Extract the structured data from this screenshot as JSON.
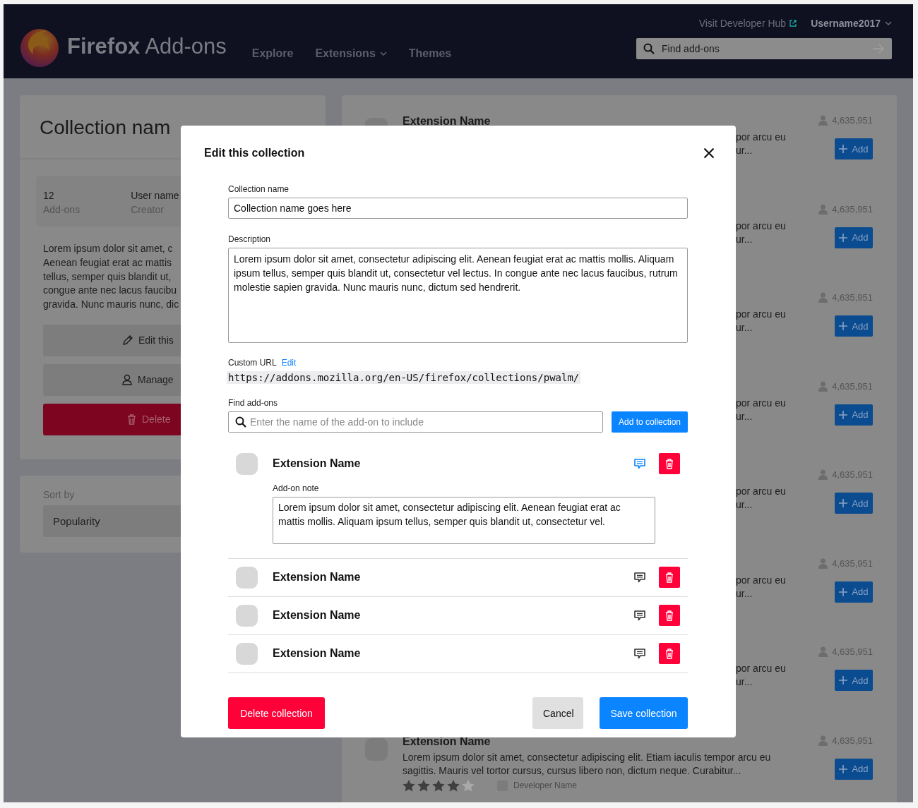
{
  "header": {
    "brand_bold": "Firefox",
    "brand_light": "Add-ons",
    "nav": [
      {
        "label": "Explore",
        "dropdown": false
      },
      {
        "label": "Extensions",
        "dropdown": true
      },
      {
        "label": "Themes",
        "dropdown": false
      }
    ],
    "developer_link": "Visit Developer Hub",
    "user_menu": "Username2017",
    "search": {
      "placeholder": "Find add-ons"
    }
  },
  "collection": {
    "title": "Collection nam",
    "stats": [
      {
        "value": "12",
        "label": "Add-ons"
      },
      {
        "value": "User name",
        "label": "Creator"
      }
    ],
    "description_lines": [
      "Lorem ipsum dolor sit amet, c",
      "Aenean feugiat erat ac mattis",
      "tellus, semper quis blandit ut,",
      "congue ante nec lacus faucibu",
      "gravida. Nunc mauris nunc, dic"
    ],
    "buttons": [
      {
        "kind": "edit",
        "label": "Edit this"
      },
      {
        "kind": "manage",
        "label": "Manage"
      },
      {
        "kind": "delete",
        "label": "Delete"
      }
    ]
  },
  "sort": {
    "label": "Sort by",
    "value": "Popularity"
  },
  "addon_list": [
    {
      "kind": "partial",
      "name": "Extension Name",
      "description_lines": [
        "por arcu eu",
        "ur..."
      ],
      "users": "4,635,951",
      "button": "Add"
    },
    {
      "kind": "partial",
      "description_lines": [
        "por arcu eu",
        "ur..."
      ],
      "users": "4,635,951",
      "button": "Add"
    },
    {
      "kind": "partial",
      "description_lines": [
        "por arcu eu",
        "ur..."
      ],
      "users": "4,635,951",
      "button": "Add"
    },
    {
      "kind": "partial",
      "description_lines": [
        "por arcu eu",
        "ur..."
      ],
      "users": "4,635,951",
      "button": "Add"
    },
    {
      "kind": "partial",
      "description_lines": [
        "por arcu eu",
        "ur..."
      ],
      "users": "4,635,951",
      "button": "Add"
    },
    {
      "kind": "partial",
      "description_lines": [
        "por arcu eu",
        "ur..."
      ],
      "users": "4,635,951",
      "button": "Add"
    },
    {
      "kind": "partial",
      "description_lines": [
        "por arcu eu",
        "ur..."
      ],
      "users": "4,635,951",
      "button": "Add"
    },
    {
      "kind": "full",
      "name": "Extension Name",
      "description_lines": [
        "Lorem ipsum dolor sit amet, consectetur adipiscing elit. Etiam iaculis tempor arcu eu",
        "sagittis. Mauris vel tortor cursus, cursus libero non, dictum neque. Curabitur..."
      ],
      "stars": 4,
      "developer": "Developer Name",
      "users": "4,635,951",
      "button": "Add"
    }
  ],
  "modal": {
    "title": "Edit this collection",
    "name_label": "Collection name",
    "name_value": "Collection name goes here",
    "description_label": "Description",
    "description_value": "Lorem ipsum dolor sit amet, consectetur adipiscing elit. Aenean feugiat erat ac mattis mollis. Aliquam ipsum tellus, semper quis blandit ut, consectetur vel lectus. In congue ante nec lacus faucibus, rutrum molestie sapien gravida. Nunc mauris nunc, dictum sed hendrerit.",
    "url_label": "Custom URL",
    "url_edit": "Edit",
    "url": "https://addons.mozilla.org/en-US/firefox/collections/pwalm/",
    "find_label": "Find add-ons",
    "find_placeholder": "Enter the name of the add-on to include",
    "add_button": "Add to collection",
    "addons": [
      {
        "name": "Extension Name",
        "note_expanded": true,
        "note_label": "Add-on note",
        "note": "Lorem ipsum dolor sit amet, consectetur adipiscing elit. Aenean feugiat erat ac mattis mollis. Aliquam ipsum tellus, semper quis blandit ut, consectetur vel."
      },
      {
        "name": "Extension Name",
        "note_expanded": false
      },
      {
        "name": "Extension Name",
        "note_expanded": false
      },
      {
        "name": "Extension Name",
        "note_expanded": false
      }
    ],
    "delete_button": "Delete collection",
    "cancel_button": "Cancel",
    "save_button": "Save collection"
  }
}
